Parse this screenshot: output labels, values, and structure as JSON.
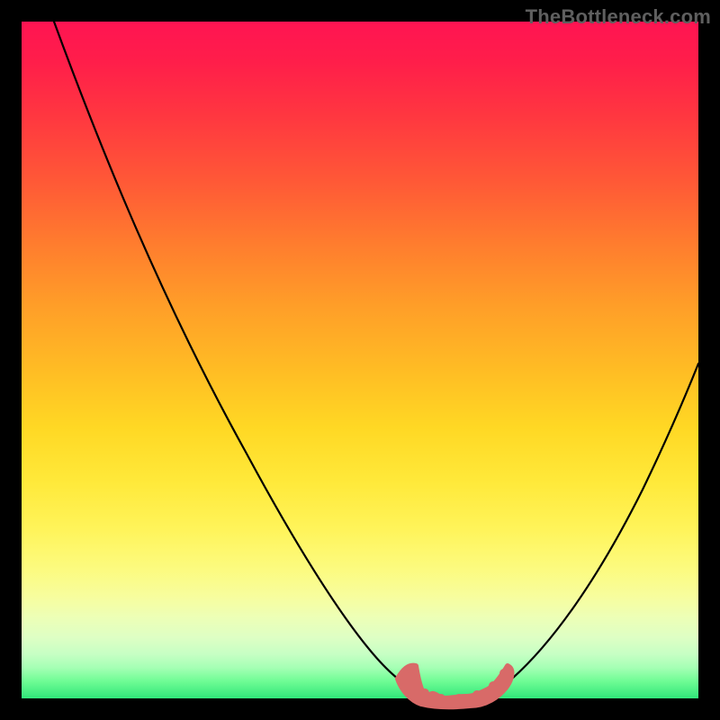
{
  "watermark": "TheBottleneck.com",
  "chart_data": {
    "type": "line",
    "title": "",
    "xlabel": "",
    "ylabel": "",
    "xlim": [
      0,
      100
    ],
    "ylim": [
      0,
      100
    ],
    "series": [
      {
        "name": "bottleneck-curve",
        "x": [
          5,
          10,
          15,
          20,
          25,
          30,
          35,
          40,
          45,
          50,
          53,
          57,
          60,
          63,
          66,
          70,
          75,
          80,
          85,
          90,
          95,
          100
        ],
        "values": [
          100,
          91,
          82,
          73,
          64,
          55,
          46,
          37,
          28,
          19,
          11,
          5,
          2,
          0,
          0,
          0,
          2,
          8,
          18,
          30,
          43,
          56
        ]
      },
      {
        "name": "optimal-zone-marker",
        "x": [
          57,
          58,
          60,
          62,
          64,
          66,
          68,
          70,
          72,
          73
        ],
        "values": [
          4,
          2,
          1,
          0.5,
          0,
          0,
          0.5,
          1,
          2,
          4
        ]
      }
    ],
    "colors": {
      "curve": "#000000",
      "marker": "#d86a68",
      "gradient_top": "#ff1452",
      "gradient_bottom": "#30e57a"
    }
  }
}
